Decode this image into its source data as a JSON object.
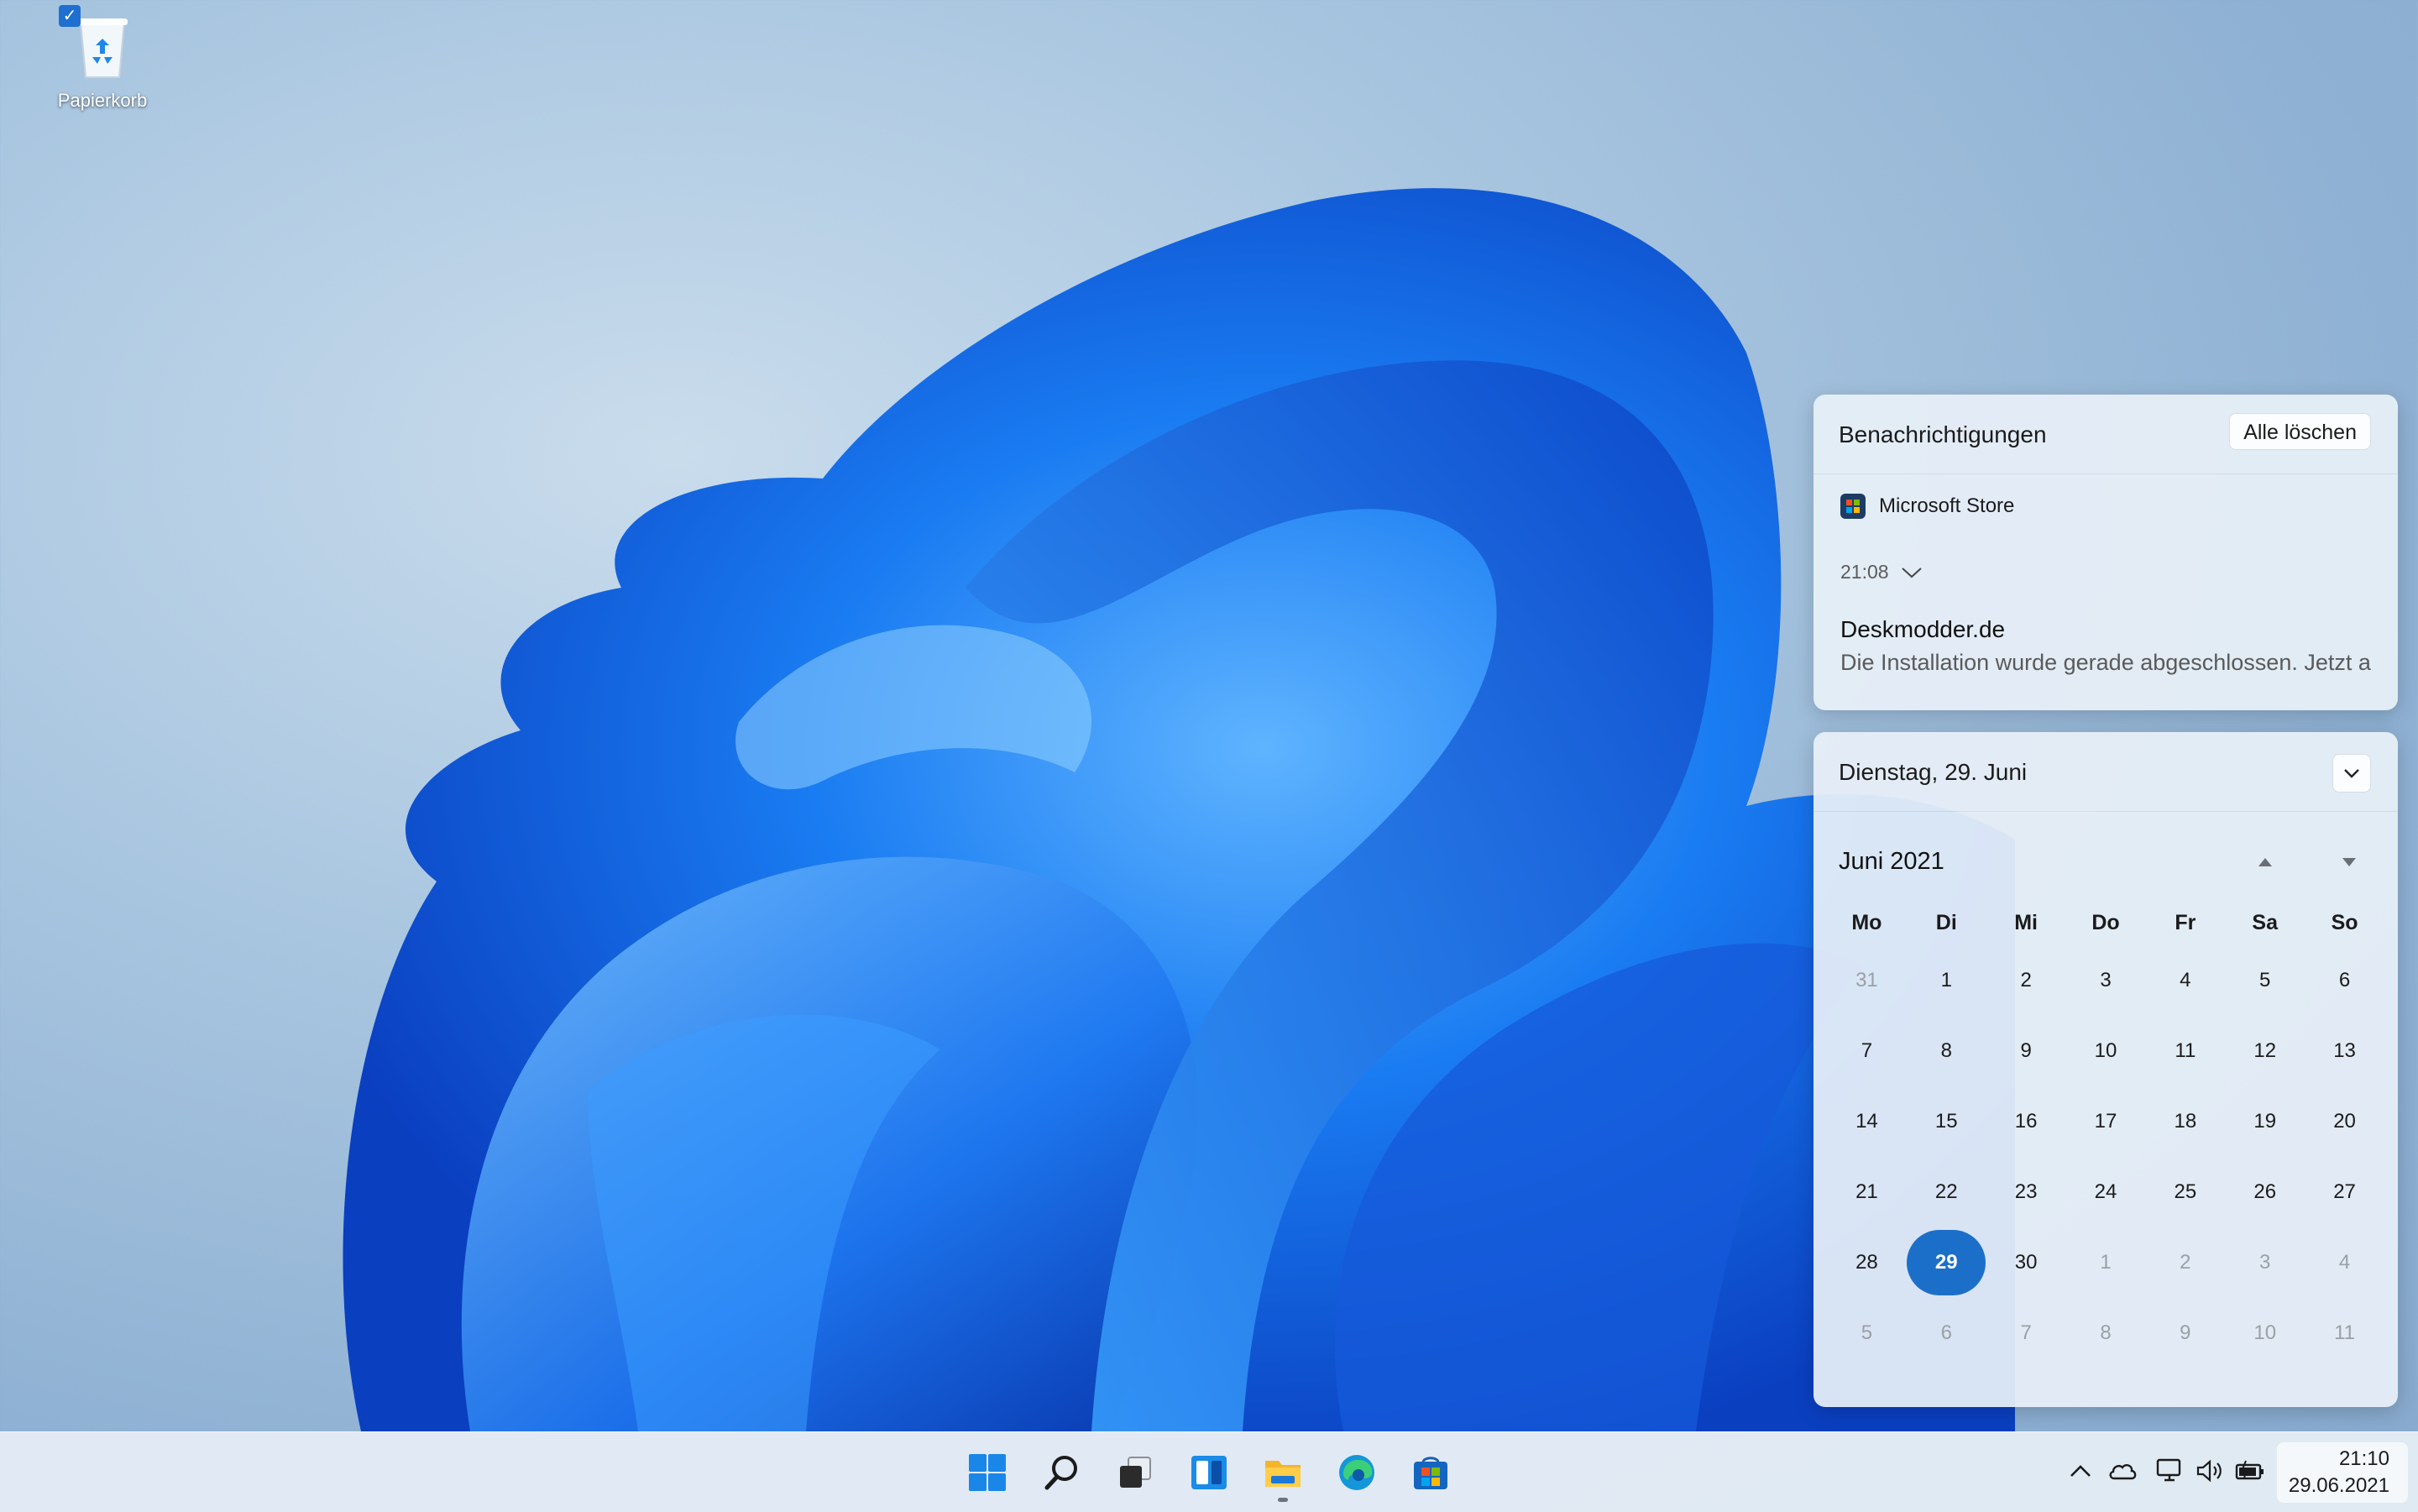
{
  "desktop": {
    "icons": [
      {
        "label": "Papierkorb",
        "icon": "recycle-bin-icon"
      }
    ]
  },
  "notifications": {
    "title": "Benachrichtigungen",
    "clear_all_label": "Alle löschen",
    "items": [
      {
        "app": "Microsoft Store",
        "app_icon": "microsoft-store-icon",
        "time": "21:08",
        "sender": "Deskmodder.de",
        "message": "Die Installation wurde gerade abgeschlossen. Jetzt a"
      }
    ]
  },
  "calendar": {
    "date_header": "Dienstag, 29. Juni",
    "month_label": "Juni 2021",
    "weekdays": [
      "Mo",
      "Di",
      "Mi",
      "Do",
      "Fr",
      "Sa",
      "So"
    ],
    "weeks": [
      [
        "31",
        "1",
        "2",
        "3",
        "4",
        "5",
        "6"
      ],
      [
        "7",
        "8",
        "9",
        "10",
        "11",
        "12",
        "13"
      ],
      [
        "14",
        "15",
        "16",
        "17",
        "18",
        "19",
        "20"
      ],
      [
        "21",
        "22",
        "23",
        "24",
        "25",
        "26",
        "27"
      ],
      [
        "28",
        "29",
        "30",
        "1",
        "2",
        "3",
        "4"
      ],
      [
        "5",
        "6",
        "7",
        "8",
        "9",
        "10",
        "11"
      ]
    ],
    "today": "29",
    "accent": "#1c6fc9"
  },
  "taskbar": {
    "apps": [
      "start-icon",
      "search-icon",
      "task-view-icon",
      "widgets-icon",
      "file-explorer-icon",
      "edge-icon",
      "microsoft-store-icon"
    ],
    "tray": [
      "chevron-up-icon",
      "onedrive-icon",
      "network-icon",
      "volume-icon",
      "battery-icon"
    ],
    "time": "21:10",
    "date": "29.06.2021"
  }
}
